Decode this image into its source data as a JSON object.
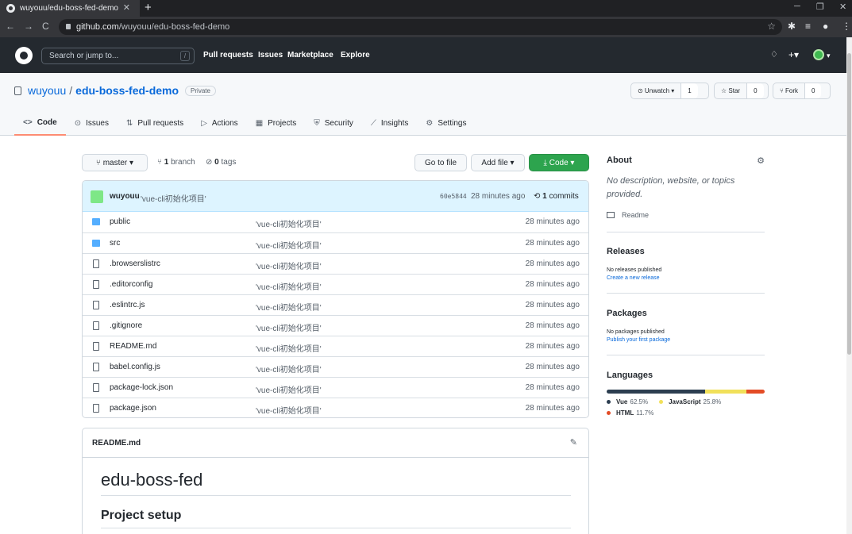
{
  "browser": {
    "tab_title": "wuyouu/edu-boss-fed-demo",
    "tab_close": "✕",
    "new_tab": "+",
    "url_host": "github.com",
    "url_path": "/wuyouu/edu-boss-fed-demo",
    "back": "←",
    "forward": "→",
    "reload": "C",
    "minimize": "─",
    "maximize": "❐",
    "close": "✕",
    "bookmark_star": "☆",
    "extensions_icon": "✱",
    "playlist_icon": "≡",
    "profile_icon": "●",
    "menu_icon": "⋮"
  },
  "gh": {
    "search_placeholder": "Search or jump to...",
    "search_key": "/",
    "nav": [
      "Pull requests",
      "Issues",
      "Marketplace",
      "Explore"
    ],
    "bell": "🔔",
    "plus": "+▾",
    "avatar_caret": "▾"
  },
  "repo": {
    "owner": "wuyouu",
    "sep": "/",
    "name": "edu-boss-fed-demo",
    "visibility": "Private",
    "watch_label": "⊙ Unwatch ▾",
    "watch_count": "1",
    "star_label": "☆ Star",
    "star_count": "0",
    "fork_label": "⑂ Fork",
    "fork_count": "0"
  },
  "tabs": [
    {
      "icon": "<>",
      "label": "Code"
    },
    {
      "icon": "⊙",
      "label": "Issues"
    },
    {
      "icon": "⇅",
      "label": "Pull requests"
    },
    {
      "icon": "▷",
      "label": "Actions"
    },
    {
      "icon": "▦",
      "label": "Projects"
    },
    {
      "icon": "⛨",
      "label": "Security"
    },
    {
      "icon": "⟋",
      "label": "Insights"
    },
    {
      "icon": "⚙",
      "label": "Settings"
    }
  ],
  "toolbar": {
    "branch_btn": "⑂ master ▾",
    "branch_count": "1",
    "branch_word": "branch",
    "tag_count": "0",
    "tag_word": "tags",
    "go_to_file": "Go to file",
    "add_file": "Add file ▾",
    "code_btn": "⤓ Code ▾"
  },
  "commit": {
    "author": "wuyouu",
    "message": "'vue-cli初始化项目'",
    "sha": "60e5844",
    "ago": "28 minutes ago",
    "commits_count": "1",
    "commits_word": "commits"
  },
  "files": [
    {
      "type": "dir",
      "name": "public",
      "msg": "'vue-cli初始化项目'",
      "age": "28 minutes ago"
    },
    {
      "type": "dir",
      "name": "src",
      "msg": "'vue-cli初始化项目'",
      "age": "28 minutes ago"
    },
    {
      "type": "file",
      "name": ".browserslistrc",
      "msg": "'vue-cli初始化项目'",
      "age": "28 minutes ago"
    },
    {
      "type": "file",
      "name": ".editorconfig",
      "msg": "'vue-cli初始化项目'",
      "age": "28 minutes ago"
    },
    {
      "type": "file",
      "name": ".eslintrc.js",
      "msg": "'vue-cli初始化项目'",
      "age": "28 minutes ago"
    },
    {
      "type": "file",
      "name": ".gitignore",
      "msg": "'vue-cli初始化项目'",
      "age": "28 minutes ago"
    },
    {
      "type": "file",
      "name": "README.md",
      "msg": "'vue-cli初始化项目'",
      "age": "28 minutes ago"
    },
    {
      "type": "file",
      "name": "babel.config.js",
      "msg": "'vue-cli初始化项目'",
      "age": "28 minutes ago"
    },
    {
      "type": "file",
      "name": "package-lock.json",
      "msg": "'vue-cli初始化项目'",
      "age": "28 minutes ago"
    },
    {
      "type": "file",
      "name": "package.json",
      "msg": "'vue-cli初始化项目'",
      "age": "28 minutes ago"
    }
  ],
  "readme": {
    "filename": "README.md",
    "edit_icon": "✎",
    "h1": "edu-boss-fed",
    "h2": "Project setup"
  },
  "sidebar": {
    "about_title": "About",
    "gear": "⚙",
    "description": "No description, website, or topics provided.",
    "readme_label": "Readme",
    "releases_title": "Releases",
    "releases_none": "No releases published",
    "releases_link": "Create a new release",
    "packages_title": "Packages",
    "packages_none": "No packages published",
    "packages_link": "Publish your first package",
    "languages_title": "Languages",
    "languages": [
      {
        "name": "Vue",
        "percent": "62.5%",
        "value": 62.5,
        "color": "#2c3e50"
      },
      {
        "name": "JavaScript",
        "percent": "25.8%",
        "value": 25.8,
        "color": "#f1e05a"
      },
      {
        "name": "HTML",
        "percent": "11.7%",
        "value": 11.7,
        "color": "#e34c26"
      }
    ]
  }
}
